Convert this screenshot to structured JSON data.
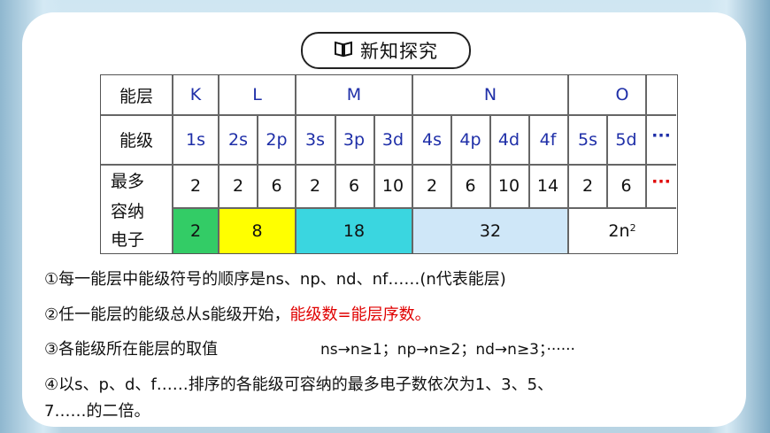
{
  "header": {
    "title": "新知探究",
    "icon": "book-icon"
  },
  "table": {
    "row_labels": [
      "能层",
      "能级",
      "最多",
      "容纳",
      "电子"
    ],
    "shells": [
      "K",
      "L",
      "M",
      "N",
      "O"
    ],
    "sublevels": [
      "1s",
      "2s",
      "2p",
      "3s",
      "3p",
      "3d",
      "4s",
      "4p",
      "4d",
      "4f",
      "5s",
      "5d",
      "···"
    ],
    "max_electrons": [
      "2",
      "2",
      "6",
      "2",
      "6",
      "10",
      "2",
      "6",
      "10",
      "14",
      "2",
      "6",
      "···"
    ],
    "shell_totals": [
      "2",
      "8",
      "18",
      "32",
      "2n"
    ],
    "shell_total_sup": "2",
    "shell_colors": [
      "#33cc66",
      "#ffff00",
      "#3ad6e0",
      "#cfe7f8",
      "#ffffff"
    ]
  },
  "notes": {
    "line1": "①每一能层中能级符号的顺序是ns、np、nd、nf……(n代表能层)",
    "line2_prefix": "②任一能层的能级总从s能级开始，",
    "line2_highlight": "能级数=能层序数。",
    "line3_prefix": "③各能级所在能层的取值",
    "line3_value": "ns→n≥1；np→n≥2；nd→n≥3；······",
    "line4a": "④以s、p、d、f……排序的各能级可容纳的最多电子数依次为1、3、5、",
    "line4b": "7……的二倍。"
  }
}
